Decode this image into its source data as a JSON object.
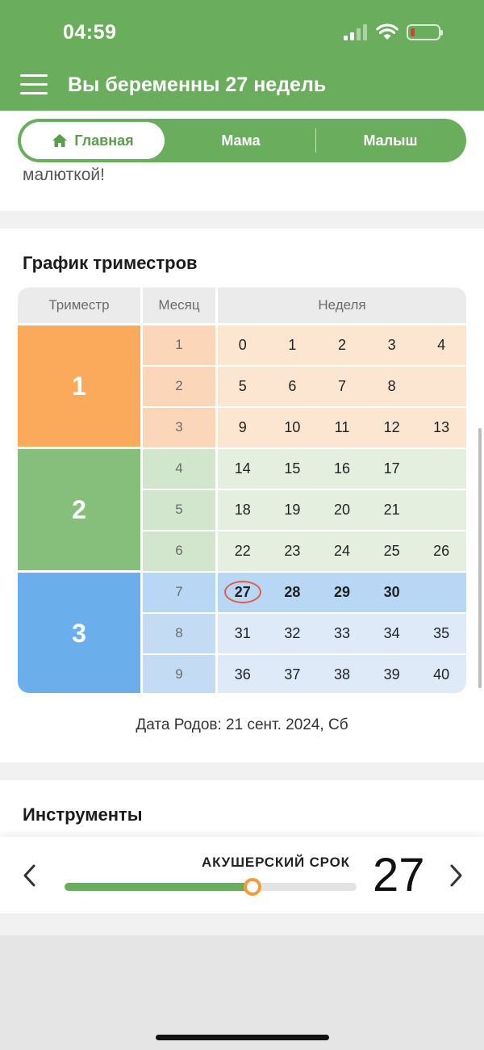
{
  "status_bar": {
    "time": "04:59"
  },
  "header": {
    "title": "Вы беременны 27 недель"
  },
  "tabs": [
    {
      "label": "Главная",
      "active": true
    },
    {
      "label": "Мама",
      "active": false
    },
    {
      "label": "Малыш",
      "active": false
    }
  ],
  "previous_text": "малюткой!",
  "schedule": {
    "title": "График триместров",
    "headers": {
      "trimester": "Триместр",
      "month": "Месяц",
      "week": "Неделя"
    },
    "trimesters": [
      {
        "label": "1",
        "color": "#fbaa5c",
        "bg": "#fde6d1",
        "month_bg": "#fcd6b8",
        "months": [
          {
            "month": "1",
            "weeks": [
              "0",
              "1",
              "2",
              "3",
              "4"
            ]
          },
          {
            "month": "2",
            "weeks": [
              "5",
              "6",
              "7",
              "8"
            ]
          },
          {
            "month": "3",
            "weeks": [
              "9",
              "10",
              "11",
              "12",
              "13"
            ]
          }
        ]
      },
      {
        "label": "2",
        "color": "#85bf7b",
        "bg": "#e4efdf",
        "month_bg": "#d1e6cc",
        "months": [
          {
            "month": "4",
            "weeks": [
              "14",
              "15",
              "16",
              "17"
            ]
          },
          {
            "month": "5",
            "weeks": [
              "18",
              "19",
              "20",
              "21"
            ]
          },
          {
            "month": "6",
            "weeks": [
              "22",
              "23",
              "24",
              "25",
              "26"
            ]
          }
        ]
      },
      {
        "label": "3",
        "color": "#6aaeeb",
        "bg": "#deeaf8",
        "month_bg": "#c4dcf3",
        "months": [
          {
            "month": "7",
            "weeks": [
              "27",
              "28",
              "29",
              "30"
            ]
          },
          {
            "month": "8",
            "weeks": [
              "31",
              "32",
              "33",
              "34",
              "35"
            ]
          },
          {
            "month": "9",
            "weeks": [
              "36",
              "37",
              "38",
              "39",
              "40"
            ]
          }
        ]
      }
    ],
    "current_week": "27",
    "current_month": "7",
    "current_month_bg": "#b8d7f4"
  },
  "due_date": "Дата Родов: 21 сент. 2024, Сб",
  "tools_title": "Инструменты",
  "slider": {
    "label": "АКУШЕРСКИЙ СРОК",
    "value": "27",
    "min": 0,
    "max": 42
  },
  "colors": {
    "brand_green": "#6aae5d",
    "thumb_orange": "#f39a3c",
    "today_ring": "#e35b47"
  }
}
